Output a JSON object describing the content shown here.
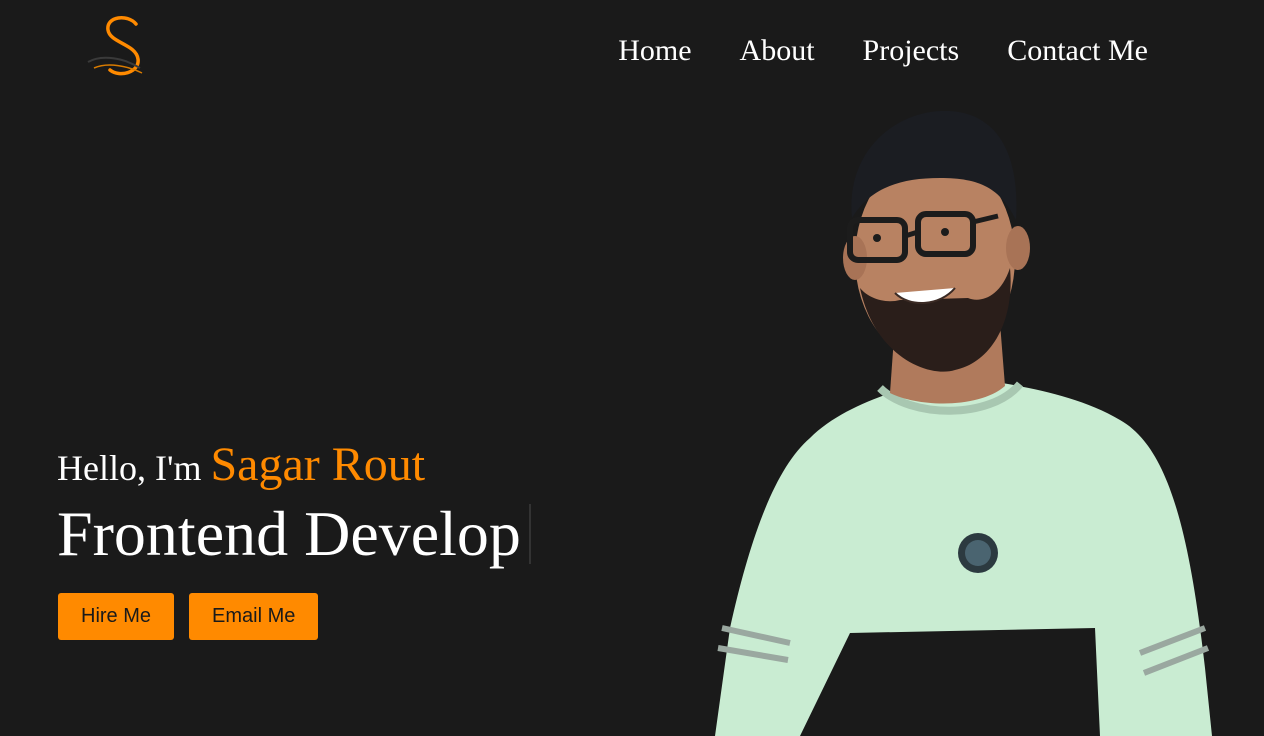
{
  "logo": {
    "letter": "S"
  },
  "nav": {
    "items": [
      "Home",
      "About",
      "Projects",
      "Contact Me"
    ]
  },
  "hero": {
    "greeting": "Hello, I'm",
    "name": "Sagar Rout",
    "role": "Frontend Develop",
    "hire_label": "Hire Me",
    "email_label": "Email Me"
  },
  "colors": {
    "background": "#1a1a1a",
    "accent": "#ff8a00",
    "text": "#ffffff",
    "shirt": "#c9ecd2"
  },
  "icons": {
    "logo": "s-monogram-logo",
    "portrait": "profile-photo"
  }
}
